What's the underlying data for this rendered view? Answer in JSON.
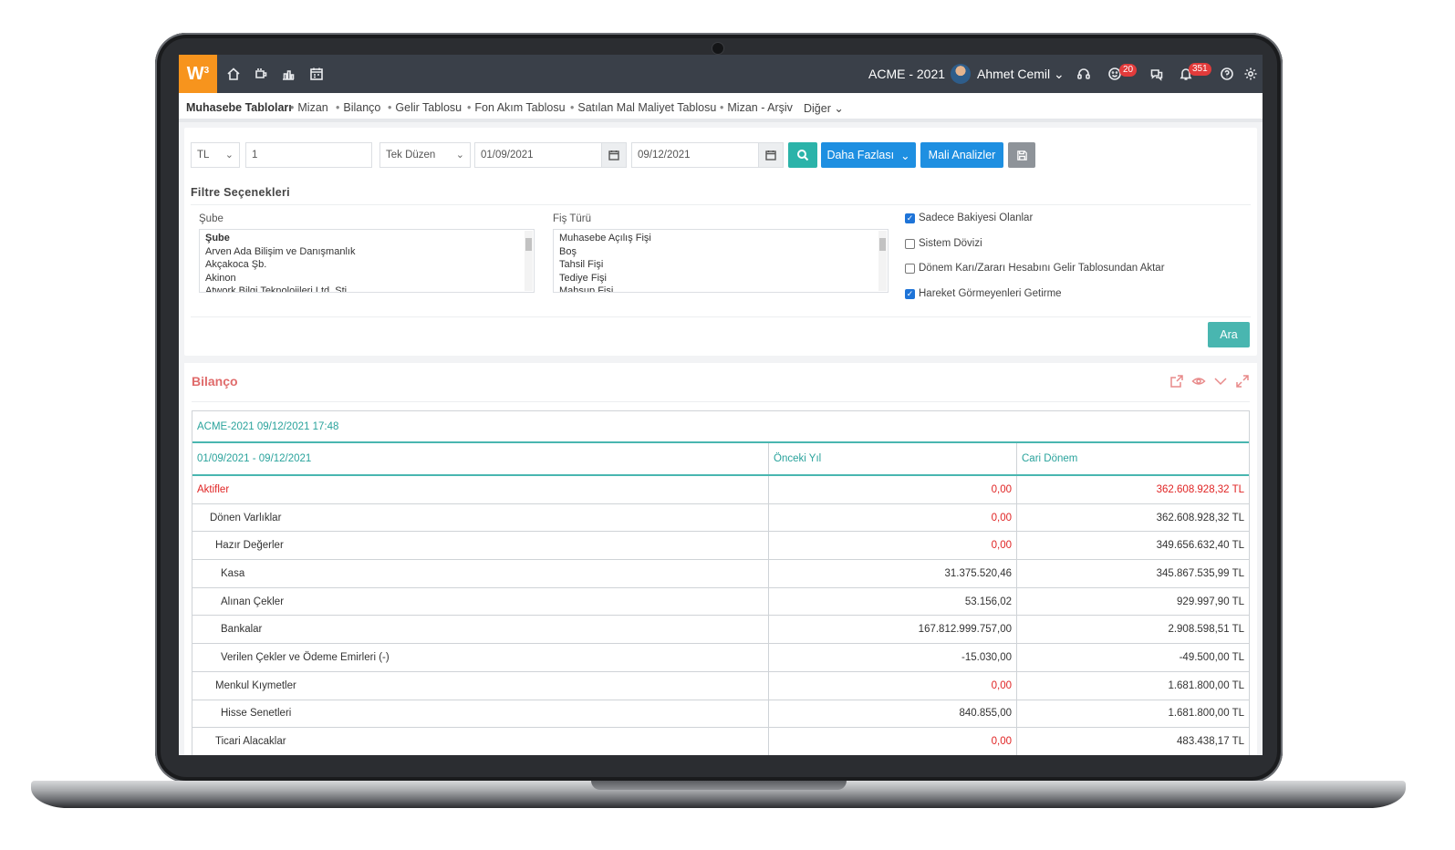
{
  "app": {
    "logo": "W",
    "logo_sup": "3"
  },
  "topbar": {
    "company": "ACME - 2021",
    "user": "Ahmet Cemil",
    "smile_badge": "20",
    "bell_badge": "351"
  },
  "menu": {
    "active": "Muhasebe Tabloları",
    "items": [
      "Mizan",
      "Bilanço",
      "Gelir Tablosu",
      "Fon Akım Tablosu",
      "Satılan Mal Maliyet Tablosu",
      "Mizan - Arşiv"
    ],
    "more": "Diğer"
  },
  "filters": {
    "currency": "TL",
    "level": "1",
    "plan": "Tek Düzen",
    "start_date": "01/09/2021",
    "end_date": "09/12/2021",
    "more_button": "Daha Fazlası",
    "analysis_button": "Mali Analizler",
    "section_title": "Filtre Seçenekleri",
    "branch_label": "Şube",
    "branch_options": [
      "Şube",
      "Arven Ada Bilişim ve Danışmanlık",
      "Akçakoca Şb.",
      "Akinon",
      "Atwork Bilgi Teknolojileri Ltd. Şti."
    ],
    "voucher_label": "Fiş Türü",
    "voucher_options": [
      "Muhasebe Açılış Fişi",
      "Boş",
      "Tahsil Fişi",
      "Tediye Fişi",
      "Mahsup Fişi"
    ],
    "checks": [
      {
        "label": "Sadece Bakiyesi Olanlar",
        "checked": true
      },
      {
        "label": "Sistem Dövizi",
        "checked": false
      },
      {
        "label": "Dönem Karı/Zararı Hesabını Gelir Tablosundan Aktar",
        "checked": false
      },
      {
        "label": "Hareket Görmeyenleri Getirme",
        "checked": true
      }
    ],
    "search_button": "Ara"
  },
  "report": {
    "title": "Bilanço",
    "caption": "ACME-2021  09/12/2021 17:48",
    "col_period": "01/09/2021 - 09/12/2021",
    "col_prev": "Önceki Yıl",
    "col_current": "Cari Dönem",
    "rows": [
      {
        "name": "Aktifler",
        "prev": "0,00",
        "cur": "362.608.928,32 TL"
      },
      {
        "name": "Dönen Varlıklar",
        "prev": "0,00",
        "cur": "362.608.928,32 TL"
      },
      {
        "name": "Hazır Değerler",
        "prev": "0,00",
        "cur": "349.656.632,40 TL"
      },
      {
        "name": "Kasa",
        "prev": "31.375.520,46",
        "cur": "345.867.535,99 TL"
      },
      {
        "name": "Alınan Çekler",
        "prev": "53.156,02",
        "cur": "929.997,90 TL"
      },
      {
        "name": "Bankalar",
        "prev": "167.812.999.757,00",
        "cur": "2.908.598,51 TL"
      },
      {
        "name": "Verilen Çekler ve Ödeme Emirleri (-)",
        "prev": "-15.030,00",
        "cur": "-49.500,00 TL"
      },
      {
        "name": "Menkul Kıymetler",
        "prev": "0,00",
        "cur": "1.681.800,00 TL"
      },
      {
        "name": "Hisse Senetleri",
        "prev": "840.855,00",
        "cur": "1.681.800,00 TL"
      },
      {
        "name": "Ticari Alacaklar",
        "prev": "0,00",
        "cur": "483.438,17 TL"
      }
    ]
  },
  "colors": {
    "orange": "#f7941d",
    "teal": "#49b6b0",
    "blue": "#1e8fe1",
    "red": "#e02424"
  }
}
